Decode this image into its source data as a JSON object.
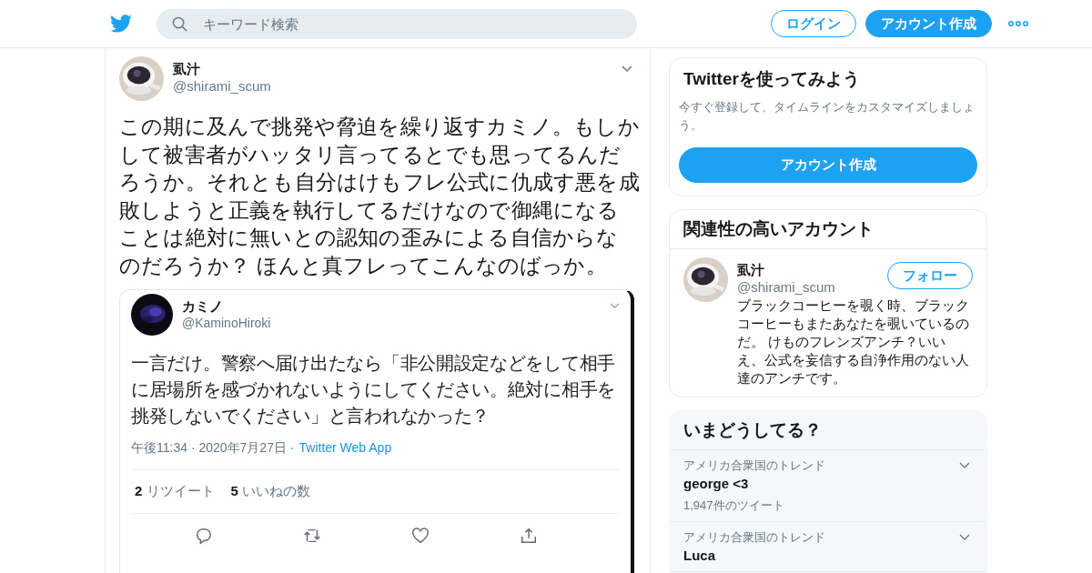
{
  "header": {
    "search": {
      "placeholder": "キーワード検索"
    },
    "buttons": [
      {
        "label": "ログイン",
        "kind": "outline"
      },
      {
        "label": "アカウント作成",
        "kind": "filled"
      }
    ]
  },
  "tweet": {
    "name": "虱汁",
    "handle": "@shirami_scum",
    "text": "この期に及んで挑発や脅迫を繰り返すカミノ。もしかして被害者がハッタリ言ってるとでも思ってるんだろうか。それとも自分はけもフレ公式に仇成す悪を成敗しようと正義を執行してるだけなので御縄になることは絶対に無いとの認知の歪みによる自信からなのだろうか？ ほんと真フレってこんなのばっか。",
    "quoted": {
      "name": "カミノ",
      "handle": "@KaminoHiroki",
      "text": "一言だけ。警察へ届け出たなら「非公開設定などをして相手に居場所を感づかれないようにしてください。絶対に相手を挑発しないでください」と言われなかった？",
      "meta": "午後11:34 · 2020年7月27日 ·",
      "source": "Twitter Web App",
      "stats": [
        {
          "count": "2",
          "label": "リツイート"
        },
        {
          "count": "5",
          "label": "いいねの数"
        }
      ]
    }
  },
  "signup": {
    "title": "Twitterを使ってみよう",
    "text": "今すぐ登録して、タイムラインをカスタマイズしましょう。",
    "button": "アカウント作成"
  },
  "related": {
    "title": "関連性の高いアカウント",
    "accounts": [
      {
        "name": "虱汁",
        "handle": "@shirami_scum",
        "button": "フォロー",
        "bio": "ブラックコーヒーを覗く時、ブラックコーヒーもまたあなたを覗いているのだ。 けものフレンズアンチ？いいえ、公式を妄信する自浄作用のない人達のアンチです。"
      }
    ]
  },
  "trends": {
    "title": "いまどうしてる？",
    "items": [
      {
        "context": "アメリカ合衆国のトレンド",
        "name": "george <3",
        "count": "1,947件のツイート"
      },
      {
        "context": "アメリカ合衆国のトレンド",
        "name": "Luca"
      }
    ]
  }
}
